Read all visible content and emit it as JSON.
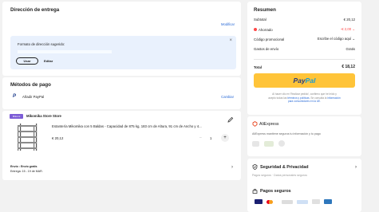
{
  "delivery": {
    "title": "Dirección de entrega",
    "modify": "Modificar",
    "suggested": "Formato de dirección sugerido:",
    "use": "Usar",
    "edit": "Editar"
  },
  "payment": {
    "title": "Métodos de pago",
    "add_paypal": "Añadir PayPal",
    "change": "Cambiar"
  },
  "store": {
    "badge": "Mikomi",
    "name": "Mikomika Store Store",
    "product": "Estantería Mikomika con 5 Baldas - Capacidad de 875 kg, 183 cm de Altura, 91 cm de Ancho y 4...",
    "price": "€ 20,12",
    "qty": "1",
    "ship_label": "Envío : Envío gratis",
    "delivery_est": "Entrega: 15 - 19 de MAR."
  },
  "summary": {
    "title": "Resumen",
    "subtotal_label": "Subtotal",
    "subtotal": "€ 20,12",
    "saved_label": "Ahorrado",
    "saved": "-€ 2,00",
    "promo_label": "Código promocional",
    "promo_input": "Escribe el código aquí",
    "shipping_label": "Gastos de envío",
    "shipping": "Gratis",
    "total_label": "Total",
    "total": "€ 18,12",
    "paypal_a": "Pay",
    "paypal_b": "Pal",
    "terms_1": "Al hacer clic en 'Realizar pedido', confirmo que he leído y",
    "terms_2": "acepto todas las",
    "terms_link": "términos y políticas",
    "terms_3": ". Se consulta la",
    "terms_link2": "información",
    "terms_4": "para consumidores en la UE."
  },
  "trust": {
    "brand": "AliExpress",
    "tagline": "AliExpress mantiene seguros tu información y tu pago",
    "security_title": "Seguridad & Privacidad",
    "security_sub": "Pagos seguros · Datos personales seguros",
    "secure_payments": "Pagos seguros"
  },
  "colors": {
    "accent": "#ff4747",
    "paypal_yellow": "#ffc439",
    "link": "#2a6ad6"
  }
}
